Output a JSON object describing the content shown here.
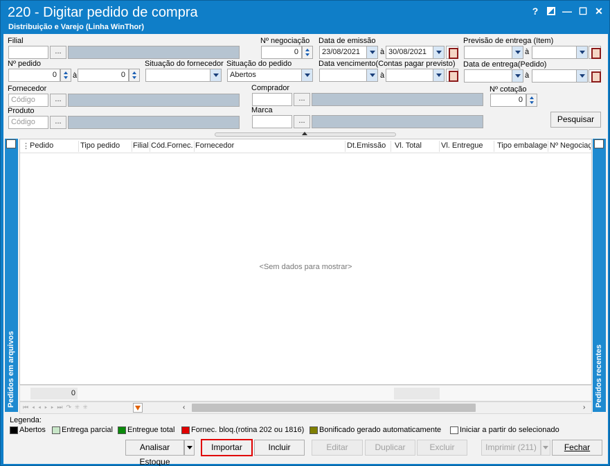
{
  "window": {
    "title": "220 - Digitar pedido de compra",
    "subtitle": "Distribuição e Varejo (Linha WinThor)",
    "help_label": "?",
    "minimize_label": "—",
    "maximize_label": "☐",
    "close_label": "✕"
  },
  "filters": {
    "filial_label": "Filial",
    "negociacao_label": "Nº negociação",
    "negociacao_value": "0",
    "emissao_label": "Data de emissão",
    "emissao_from": "23/08/2021",
    "emissao_to": "30/08/2021",
    "previsao_label": "Previsão  de entrega (Item)",
    "pedido_label": "Nº pedido",
    "pedido_from": "0",
    "pedido_to": "0",
    "situacao_fornecedor_label": "Situação do fornecedor",
    "situacao_pedido_label": "Situação do pedido",
    "situacao_pedido_value": "Abertos",
    "vencimento_label": "Data vencimento(Contas pagar previsto)",
    "entrega_pedido_label": "Data de entrega(Pedido)",
    "fornecedor_label": "Fornecedor",
    "fornecedor_placeholder": "Código",
    "comprador_label": "Comprador",
    "cotacao_label": "Nº cotação",
    "cotacao_value": "0",
    "produto_label": "Produto",
    "produto_placeholder": "Código",
    "marca_label": "Marca",
    "a_label": "à",
    "dots_label": "...",
    "pesquisar_label": "Pesquisar"
  },
  "grid": {
    "columns": [
      "Pedido",
      "Tipo pedido",
      "Filial",
      "Cód.Fornec.",
      "Fornecedor",
      "Dt.Emissão",
      "Vl. Total",
      "Vl. Entregue",
      "Tipo embalager",
      "Nº Negociaç"
    ],
    "empty_text": "<Sem dados para mostrar>",
    "footer_count": "0",
    "left_panel_label": "Pedidos em arquivos",
    "right_panel_label": "Pedidos recentes"
  },
  "legend": {
    "title": "Legenda:",
    "items": [
      {
        "label": "Abertos",
        "color": "#000000"
      },
      {
        "label": "Entrega parcial",
        "color": "#c8e6c8"
      },
      {
        "label": "Entregue total",
        "color": "#0b8a0b"
      },
      {
        "label": "Fornec. bloq.(rotina 202 ou 1816)",
        "color": "#e00000"
      },
      {
        "label": "Bonificado gerado automaticamente",
        "color": "#7f7f00"
      },
      {
        "label": "Iniciar a partir do selecionado",
        "color": "#ffffff"
      }
    ]
  },
  "actions": {
    "analisar": "Analisar Estoque",
    "importar": "Importar",
    "incluir": "Incluir",
    "editar": "Editar",
    "duplicar": "Duplicar",
    "excluir": "Excluir",
    "imprimir": "Imprimir (211)",
    "fechar": "Fechar"
  },
  "colors": {
    "titlebar": "#0f7ec8",
    "highlight": "#e00000"
  }
}
